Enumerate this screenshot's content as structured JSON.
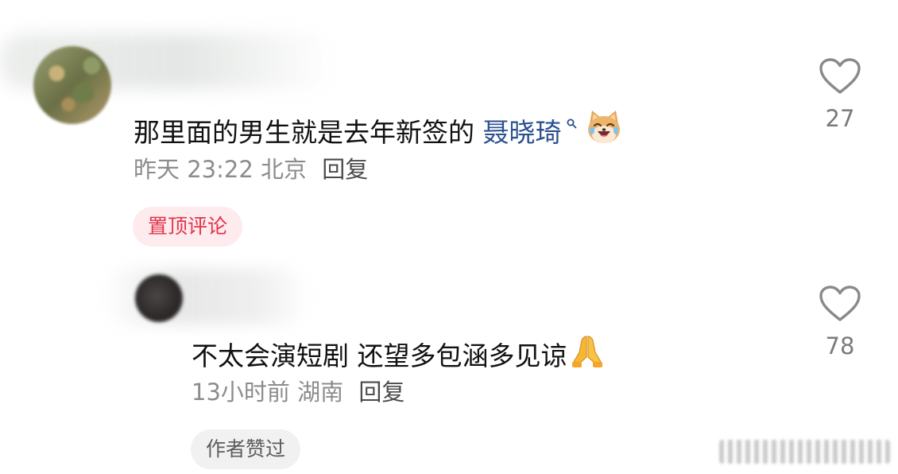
{
  "comments": [
    {
      "text_prefix": "那里面的男生就是去年新签的 ",
      "mention": "聂晓琦",
      "time": "昨天 23:22",
      "location": "北京",
      "reply_label": "回复",
      "badge": "置顶评论",
      "likes": "27",
      "emoji": "laughing-dog-emoji"
    },
    {
      "text": "不太会演短剧 还望多包涵多见谅",
      "time": "13小时前",
      "location": "湖南",
      "reply_label": "回复",
      "badge": "作者赞过",
      "likes": "78",
      "emoji": "praying-hands-emoji"
    }
  ],
  "colors": {
    "mention": "#2b4f8f",
    "pinned_badge_bg": "#fdebed",
    "pinned_badge_text": "#e3334b",
    "meta_text": "#8c8c8c",
    "author_badge_bg": "#f1f1f1"
  },
  "icons": [
    "heart-outline-icon",
    "search-icon",
    "laughing-dog-emoji",
    "praying-hands-emoji"
  ]
}
